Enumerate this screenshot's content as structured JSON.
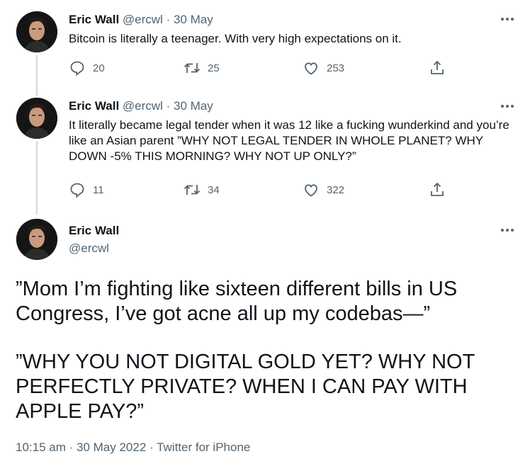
{
  "tweets": [
    {
      "name": "Eric Wall",
      "handle": "@ercwl",
      "separator": "·",
      "date": "30 May",
      "text": "Bitcoin is literally a teenager. With very high expectations on it.",
      "replies": "20",
      "retweets": "25",
      "likes": "253"
    },
    {
      "name": "Eric Wall",
      "handle": "@ercwl",
      "separator": "·",
      "date": "30 May",
      "text": "It literally became legal tender when it was 12 like a fucking wunderkind and you’re like an Asian parent ”WHY NOT LEGAL TENDER IN WHOLE PLANET? WHY DOWN -5% THIS MORNING? WHY NOT UP ONLY?”",
      "replies": "11",
      "retweets": "34",
      "likes": "322"
    }
  ],
  "main_tweet": {
    "name": "Eric Wall",
    "handle": "@ercwl",
    "paragraph1": "”Mom I’m fighting like sixteen different bills in US Congress, I’ve got acne all up my codebas—”",
    "paragraph2": "”WHY YOU NOT DIGITAL GOLD YET? WHY NOT PERFECTLY PRIVATE? WHEN I CAN PAY WITH APPLE PAY?”",
    "timestamp": "10:15 am · 30 May 2022 · Twitter for iPhone"
  },
  "icons": {
    "reply": "reply-icon",
    "retweet": "retweet-icon",
    "like": "heart-icon",
    "share": "share-icon",
    "more": "more-icon"
  },
  "colors": {
    "text": "#0f1419",
    "secondary": "#536471",
    "thread_line": "#cfd9de"
  }
}
